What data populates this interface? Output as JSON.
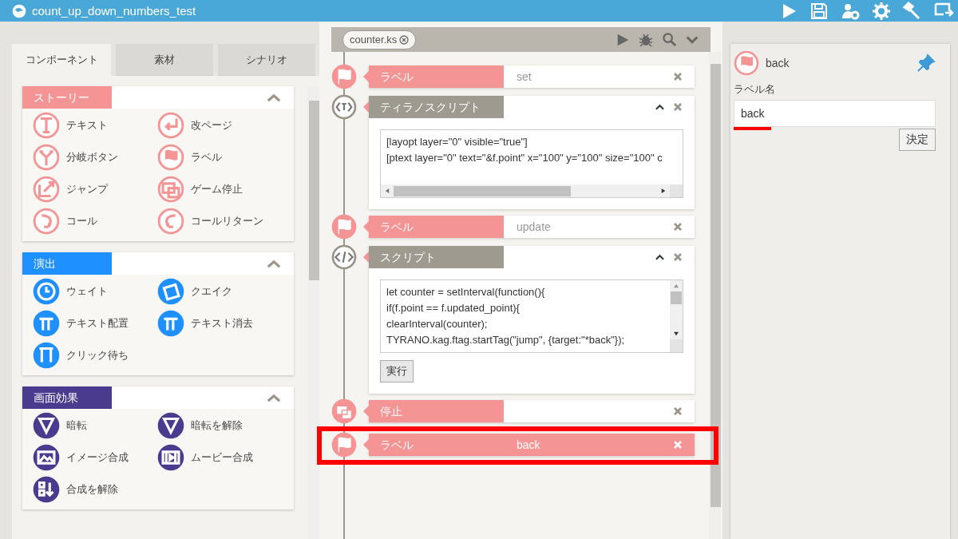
{
  "window": {
    "title": "count_up_down_numbers_test"
  },
  "tabs": [
    {
      "label": "コンポーネント",
      "selected": true
    },
    {
      "label": "素材",
      "selected": false
    },
    {
      "label": "シナリオ",
      "selected": false
    }
  ],
  "sections": [
    {
      "title": "ストーリー",
      "color": "#f59494",
      "expanded": true,
      "items": [
        "テキスト",
        "改ページ",
        "分岐ボタン",
        "ラベル",
        "ジャンプ",
        "ゲーム停止",
        "コール",
        "コールリターン"
      ]
    },
    {
      "title": "演出",
      "color": "#1e90ff",
      "expanded": true,
      "items": [
        "ウェイト",
        "クエイク",
        "テキスト配置",
        "テキスト消去",
        "クリック待ち"
      ]
    },
    {
      "title": "画面効果",
      "color": "#4b3b8f",
      "expanded": true,
      "items": [
        "暗転",
        "暗転を解除",
        "イメージ合成",
        "ムービー合成",
        "合成を解除"
      ]
    }
  ],
  "file_tab": {
    "label": "counter.ks"
  },
  "blocks": [
    {
      "kind": "label",
      "title": "ラベル",
      "value": "set",
      "highlighted": false
    },
    {
      "kind": "tyrano",
      "title": "ティラノスクリプト",
      "expanded": true,
      "lines": [
        "[layopt layer=\"0\" visible=\"true\"]",
        "[ptext layer=\"0\" text=\"&f.point\" x=\"100\" y=\"100\" size=\"100\" c"
      ]
    },
    {
      "kind": "label",
      "title": "ラベル",
      "value": "update",
      "highlighted": false
    },
    {
      "kind": "script",
      "title": "スクリプト",
      "expanded": true,
      "lines": [
        "let counter = setInterval(function(){",
        "if(f.point == f.updated_point){",
        "clearInterval(counter);",
        "TYRANO.kag.ftag.startTag(\"jump\", {target:\"*back\"});"
      ],
      "button": "実行"
    },
    {
      "kind": "stop",
      "title": "停止",
      "highlighted": false
    },
    {
      "kind": "label",
      "title": "ラベル",
      "value": "back",
      "highlighted": true
    }
  ],
  "inspector": {
    "title": "back",
    "field_label": "ラベル名",
    "value": "back",
    "underlined": true,
    "button": "決定"
  }
}
